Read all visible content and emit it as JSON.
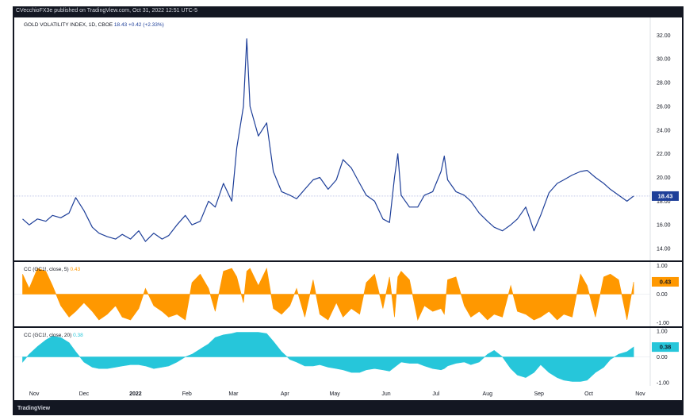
{
  "header": {
    "text": "CVecchioFX3e published on TradingView.com, Oct 31, 2022 12:51 UTC-5"
  },
  "footer": {
    "logo": "TradingView"
  },
  "chart_data": [
    {
      "type": "line",
      "legend": "GOLD VOLATILITY INDEX, 1D, CBOE",
      "legend_value": "18.43",
      "legend_change": "+0.42 (+2.33%)",
      "last_value_label": "18.43",
      "color": "#1e3f99",
      "ylim": [
        13.0,
        33.5
      ],
      "yticks": [
        "14.00",
        "16.00",
        "18.00",
        "20.00",
        "22.00",
        "24.00",
        "26.00",
        "28.00",
        "30.00",
        "32.00"
      ],
      "x": [
        "2021-10-25",
        "2021-10-29",
        "2021-11-03",
        "2021-11-08",
        "2021-11-12",
        "2021-11-17",
        "2021-11-22",
        "2021-11-26",
        "2021-12-01",
        "2021-12-06",
        "2021-12-10",
        "2021-12-15",
        "2021-12-20",
        "2021-12-24",
        "2021-12-29",
        "2022-01-03",
        "2022-01-07",
        "2022-01-12",
        "2022-01-17",
        "2022-01-21",
        "2022-01-26",
        "2022-01-31",
        "2022-02-04",
        "2022-02-09",
        "2022-02-14",
        "2022-02-18",
        "2022-02-23",
        "2022-02-28",
        "2022-03-03",
        "2022-03-07",
        "2022-03-09",
        "2022-03-11",
        "2022-03-16",
        "2022-03-21",
        "2022-03-25",
        "2022-03-30",
        "2022-04-04",
        "2022-04-08",
        "2022-04-13",
        "2022-04-18",
        "2022-04-22",
        "2022-04-27",
        "2022-05-02",
        "2022-05-06",
        "2022-05-11",
        "2022-05-16",
        "2022-05-20",
        "2022-05-25",
        "2022-05-30",
        "2022-06-03",
        "2022-06-06",
        "2022-06-08",
        "2022-06-10",
        "2022-06-15",
        "2022-06-20",
        "2022-06-24",
        "2022-06-29",
        "2022-07-04",
        "2022-07-06",
        "2022-07-08",
        "2022-07-13",
        "2022-07-18",
        "2022-07-22",
        "2022-07-27",
        "2022-08-01",
        "2022-08-05",
        "2022-08-10",
        "2022-08-15",
        "2022-08-19",
        "2022-08-24",
        "2022-08-29",
        "2022-09-02",
        "2022-09-07",
        "2022-09-12",
        "2022-09-16",
        "2022-09-21",
        "2022-09-26",
        "2022-09-30",
        "2022-10-05",
        "2022-10-10",
        "2022-10-14",
        "2022-10-19",
        "2022-10-24",
        "2022-10-28"
      ],
      "y": [
        16.5,
        16.0,
        16.5,
        16.3,
        16.8,
        16.6,
        17.0,
        18.3,
        17.2,
        15.8,
        15.3,
        15.0,
        14.8,
        15.2,
        14.8,
        15.5,
        14.6,
        15.3,
        14.8,
        15.1,
        16.0,
        16.8,
        16.0,
        16.3,
        18.0,
        17.5,
        19.5,
        18.0,
        22.5,
        26.0,
        31.7,
        26.0,
        23.5,
        24.6,
        20.5,
        18.8,
        18.5,
        18.2,
        19.0,
        19.8,
        20.0,
        19.0,
        19.8,
        21.5,
        20.8,
        19.5,
        18.5,
        18.0,
        16.5,
        16.2,
        20.0,
        22.0,
        18.5,
        17.5,
        17.5,
        18.5,
        18.8,
        20.5,
        21.8,
        19.8,
        18.8,
        18.5,
        18.0,
        17.0,
        16.3,
        15.8,
        15.5,
        16.0,
        16.5,
        17.5,
        15.5,
        16.8,
        18.7,
        19.5,
        19.8,
        20.2,
        20.5,
        20.6,
        20.0,
        19.5,
        19.0,
        18.5,
        18.0,
        18.43
      ]
    },
    {
      "type": "area",
      "legend": "CC (GC1!, close, 5)",
      "legend_value": "0.43",
      "last_value_label": "0.43",
      "color": "#ff9800",
      "ylim": [
        -1.12,
        1.12
      ],
      "yticks": [
        "1.00",
        "0.00",
        "-1.00"
      ],
      "x": [
        "2021-10-25",
        "2021-10-29",
        "2021-11-03",
        "2021-11-08",
        "2021-11-12",
        "2021-11-17",
        "2021-11-22",
        "2021-11-26",
        "2021-12-01",
        "2021-12-06",
        "2021-12-10",
        "2021-12-15",
        "2021-12-20",
        "2021-12-24",
        "2021-12-29",
        "2022-01-03",
        "2022-01-07",
        "2022-01-12",
        "2022-01-17",
        "2022-01-21",
        "2022-01-26",
        "2022-01-31",
        "2022-02-04",
        "2022-02-09",
        "2022-02-14",
        "2022-02-18",
        "2022-02-23",
        "2022-02-28",
        "2022-03-03",
        "2022-03-07",
        "2022-03-09",
        "2022-03-11",
        "2022-03-16",
        "2022-03-21",
        "2022-03-25",
        "2022-03-30",
        "2022-04-04",
        "2022-04-08",
        "2022-04-13",
        "2022-04-18",
        "2022-04-22",
        "2022-04-27",
        "2022-05-02",
        "2022-05-06",
        "2022-05-11",
        "2022-05-16",
        "2022-05-20",
        "2022-05-25",
        "2022-05-30",
        "2022-06-03",
        "2022-06-06",
        "2022-06-08",
        "2022-06-10",
        "2022-06-15",
        "2022-06-20",
        "2022-06-24",
        "2022-06-29",
        "2022-07-04",
        "2022-07-06",
        "2022-07-08",
        "2022-07-13",
        "2022-07-18",
        "2022-07-22",
        "2022-07-27",
        "2022-08-01",
        "2022-08-05",
        "2022-08-10",
        "2022-08-15",
        "2022-08-19",
        "2022-08-24",
        "2022-08-29",
        "2022-09-02",
        "2022-09-07",
        "2022-09-12",
        "2022-09-16",
        "2022-09-21",
        "2022-09-26",
        "2022-09-30",
        "2022-10-05",
        "2022-10-10",
        "2022-10-14",
        "2022-10-19",
        "2022-10-24",
        "2022-10-28"
      ],
      "y": [
        0.7,
        0.2,
        0.9,
        0.8,
        0.3,
        -0.4,
        -0.8,
        -0.6,
        -0.3,
        -0.6,
        -0.9,
        -0.7,
        -0.4,
        -0.8,
        -0.9,
        -0.5,
        0.2,
        -0.4,
        -0.6,
        -0.8,
        -0.7,
        -0.9,
        0.4,
        0.7,
        0.2,
        -0.6,
        0.8,
        0.9,
        0.6,
        -0.3,
        0.8,
        0.9,
        0.3,
        0.9,
        -0.5,
        -0.7,
        -0.4,
        0.2,
        -0.8,
        0.5,
        -0.7,
        -0.9,
        -0.3,
        -0.8,
        -0.5,
        -0.7,
        0.4,
        0.7,
        -0.5,
        0.6,
        -0.8,
        0.6,
        0.8,
        0.5,
        -0.9,
        -0.4,
        -0.6,
        -0.5,
        -0.7,
        0.5,
        0.6,
        -0.4,
        -0.8,
        -0.6,
        -0.9,
        -0.7,
        -0.8,
        0.3,
        -0.6,
        -0.7,
        -0.9,
        -0.8,
        -0.6,
        -0.9,
        -0.7,
        -0.8,
        0.7,
        0.3,
        -0.8,
        0.6,
        0.7,
        0.5,
        -0.9,
        0.43
      ]
    },
    {
      "type": "area",
      "legend": "CC (GC1!, close, 20)",
      "legend_value": "0.38",
      "last_value_label": "0.38",
      "color": "#26c6da",
      "ylim": [
        -1.12,
        1.12
      ],
      "yticks": [
        "1.00",
        "0.00",
        "-1.00"
      ],
      "x": [
        "2021-10-25",
        "2021-10-29",
        "2021-11-03",
        "2021-11-08",
        "2021-11-12",
        "2021-11-17",
        "2021-11-22",
        "2021-11-26",
        "2021-12-01",
        "2021-12-06",
        "2021-12-10",
        "2021-12-15",
        "2021-12-20",
        "2021-12-24",
        "2021-12-29",
        "2022-01-03",
        "2022-01-07",
        "2022-01-12",
        "2022-01-17",
        "2022-01-21",
        "2022-01-26",
        "2022-01-31",
        "2022-02-04",
        "2022-02-09",
        "2022-02-14",
        "2022-02-18",
        "2022-02-23",
        "2022-02-28",
        "2022-03-03",
        "2022-03-07",
        "2022-03-09",
        "2022-03-11",
        "2022-03-16",
        "2022-03-21",
        "2022-03-25",
        "2022-03-30",
        "2022-04-04",
        "2022-04-08",
        "2022-04-13",
        "2022-04-18",
        "2022-04-22",
        "2022-04-27",
        "2022-05-02",
        "2022-05-06",
        "2022-05-11",
        "2022-05-16",
        "2022-05-20",
        "2022-05-25",
        "2022-05-30",
        "2022-06-03",
        "2022-06-06",
        "2022-06-08",
        "2022-06-10",
        "2022-06-15",
        "2022-06-20",
        "2022-06-24",
        "2022-06-29",
        "2022-07-04",
        "2022-07-06",
        "2022-07-08",
        "2022-07-13",
        "2022-07-18",
        "2022-07-22",
        "2022-07-27",
        "2022-08-01",
        "2022-08-05",
        "2022-08-10",
        "2022-08-15",
        "2022-08-19",
        "2022-08-24",
        "2022-08-29",
        "2022-09-02",
        "2022-09-07",
        "2022-09-12",
        "2022-09-16",
        "2022-09-21",
        "2022-09-26",
        "2022-09-30",
        "2022-10-05",
        "2022-10-10",
        "2022-10-14",
        "2022-10-19",
        "2022-10-24",
        "2022-10-28"
      ],
      "y": [
        -0.2,
        0.1,
        0.4,
        0.65,
        0.8,
        0.75,
        0.55,
        0.2,
        -0.2,
        -0.4,
        -0.45,
        -0.45,
        -0.4,
        -0.35,
        -0.3,
        -0.3,
        -0.35,
        -0.45,
        -0.4,
        -0.35,
        -0.2,
        0.0,
        0.1,
        0.3,
        0.5,
        0.75,
        0.85,
        0.9,
        0.95,
        0.95,
        0.95,
        0.95,
        0.95,
        0.9,
        0.6,
        0.2,
        -0.1,
        -0.2,
        -0.35,
        -0.35,
        -0.3,
        -0.4,
        -0.45,
        -0.5,
        -0.6,
        -0.6,
        -0.5,
        -0.45,
        -0.5,
        -0.55,
        -0.4,
        -0.3,
        -0.2,
        -0.25,
        -0.25,
        -0.35,
        -0.45,
        -0.5,
        -0.45,
        -0.35,
        -0.25,
        -0.2,
        -0.3,
        -0.2,
        0.1,
        0.25,
        0.0,
        -0.45,
        -0.7,
        -0.8,
        -0.6,
        -0.3,
        -0.6,
        -0.8,
        -0.9,
        -0.95,
        -0.95,
        -0.9,
        -0.6,
        -0.4,
        -0.1,
        0.1,
        0.2,
        0.38
      ]
    }
  ],
  "x_axis": {
    "labels": [
      {
        "text": "Nov",
        "date": "2021-11-01",
        "bold": false
      },
      {
        "text": "Dec",
        "date": "2021-12-01",
        "bold": false
      },
      {
        "text": "2022",
        "date": "2022-01-01",
        "bold": true
      },
      {
        "text": "Feb",
        "date": "2022-02-01",
        "bold": false
      },
      {
        "text": "Mar",
        "date": "2022-03-01",
        "bold": false
      },
      {
        "text": "Apr",
        "date": "2022-04-01",
        "bold": false
      },
      {
        "text": "May",
        "date": "2022-05-01",
        "bold": false
      },
      {
        "text": "Jun",
        "date": "2022-06-01",
        "bold": false
      },
      {
        "text": "Jul",
        "date": "2022-07-01",
        "bold": false
      },
      {
        "text": "Aug",
        "date": "2022-08-01",
        "bold": false
      },
      {
        "text": "Sep",
        "date": "2022-09-01",
        "bold": false
      },
      {
        "text": "Oct",
        "date": "2022-10-01",
        "bold": false
      },
      {
        "text": "Nov",
        "date": "2022-11-01",
        "bold": false
      }
    ]
  }
}
